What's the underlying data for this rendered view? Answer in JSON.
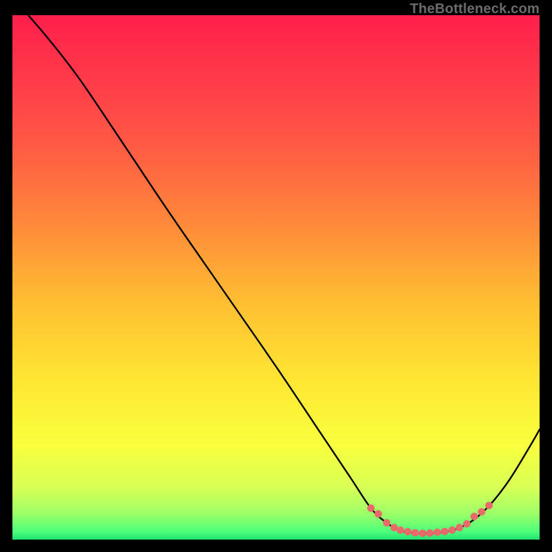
{
  "watermark": "TheBottleneck.com",
  "chart_data": {
    "type": "line",
    "title": "",
    "xlabel": "",
    "ylabel": "",
    "xlim": [
      0,
      100
    ],
    "ylim": [
      0,
      100
    ],
    "gradient_stops": [
      {
        "offset": 0.0,
        "color": "#ff1f4b"
      },
      {
        "offset": 0.12,
        "color": "#ff3a4a"
      },
      {
        "offset": 0.25,
        "color": "#ff5a44"
      },
      {
        "offset": 0.4,
        "color": "#ff8a3a"
      },
      {
        "offset": 0.55,
        "color": "#ffbf32"
      },
      {
        "offset": 0.7,
        "color": "#ffe733"
      },
      {
        "offset": 0.82,
        "color": "#f8ff3d"
      },
      {
        "offset": 0.9,
        "color": "#d9ff55"
      },
      {
        "offset": 0.95,
        "color": "#9eff68"
      },
      {
        "offset": 0.985,
        "color": "#4dff7a"
      },
      {
        "offset": 1.0,
        "color": "#20e070"
      }
    ],
    "series": [
      {
        "name": "bottleneck-curve",
        "color": "#000000",
        "stroke_width": 2.4,
        "points": [
          {
            "x": 3.0,
            "y": 100.0
          },
          {
            "x": 6.0,
            "y": 96.5
          },
          {
            "x": 10.0,
            "y": 91.5
          },
          {
            "x": 14.0,
            "y": 86.0
          },
          {
            "x": 22.0,
            "y": 74.0
          },
          {
            "x": 30.0,
            "y": 62.0
          },
          {
            "x": 40.0,
            "y": 47.5
          },
          {
            "x": 50.0,
            "y": 33.0
          },
          {
            "x": 58.0,
            "y": 21.0
          },
          {
            "x": 64.0,
            "y": 12.0
          },
          {
            "x": 68.0,
            "y": 6.0
          },
          {
            "x": 71.0,
            "y": 3.2
          },
          {
            "x": 74.0,
            "y": 1.6
          },
          {
            "x": 78.0,
            "y": 1.2
          },
          {
            "x": 82.0,
            "y": 1.5
          },
          {
            "x": 86.0,
            "y": 2.8
          },
          {
            "x": 90.0,
            "y": 6.0
          },
          {
            "x": 94.0,
            "y": 11.0
          },
          {
            "x": 98.0,
            "y": 17.5
          },
          {
            "x": 100.0,
            "y": 21.0
          }
        ]
      },
      {
        "name": "highlight-dots",
        "color": "#e86a6a",
        "marker_radius": 5.4,
        "points": [
          {
            "x": 68.0,
            "y": 6.0
          },
          {
            "x": 69.4,
            "y": 4.9
          },
          {
            "x": 71.0,
            "y": 3.2
          },
          {
            "x": 72.4,
            "y": 2.3
          },
          {
            "x": 73.6,
            "y": 1.8
          },
          {
            "x": 75.0,
            "y": 1.5
          },
          {
            "x": 76.4,
            "y": 1.3
          },
          {
            "x": 77.8,
            "y": 1.2
          },
          {
            "x": 79.2,
            "y": 1.25
          },
          {
            "x": 80.6,
            "y": 1.4
          },
          {
            "x": 82.0,
            "y": 1.55
          },
          {
            "x": 83.4,
            "y": 1.8
          },
          {
            "x": 84.8,
            "y": 2.3
          },
          {
            "x": 86.2,
            "y": 3.0
          },
          {
            "x": 87.6,
            "y": 4.4
          },
          {
            "x": 89.0,
            "y": 5.3
          },
          {
            "x": 90.4,
            "y": 6.5
          }
        ]
      }
    ]
  }
}
